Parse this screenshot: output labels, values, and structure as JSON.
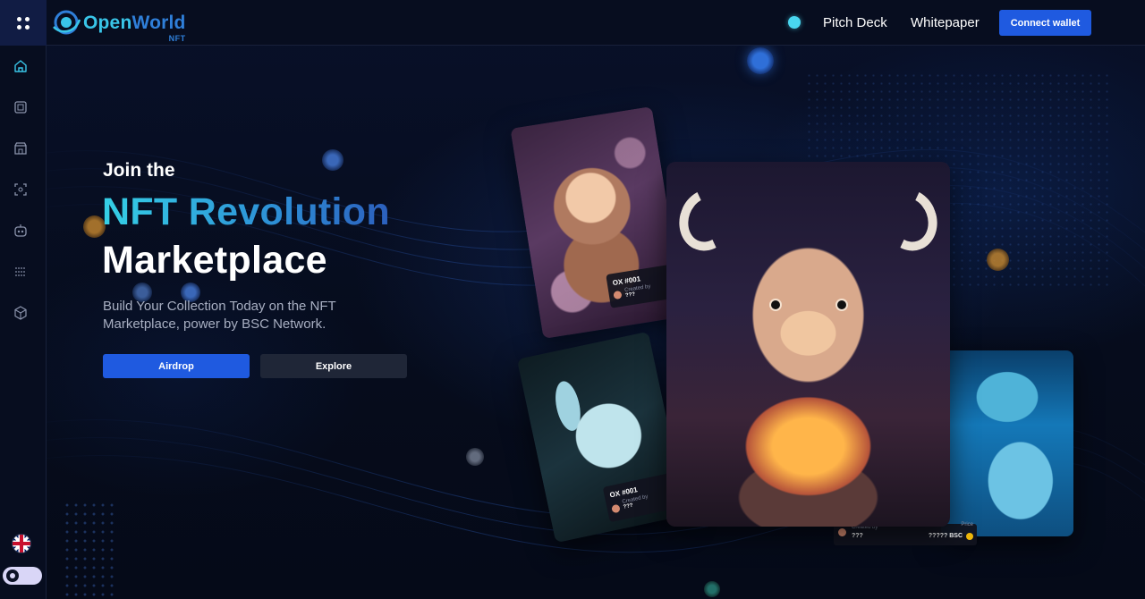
{
  "brand": {
    "name_part1": "Open",
    "name_part2": "World",
    "sub": "NFT"
  },
  "header": {
    "nav": [
      {
        "label": "Pitch Deck"
      },
      {
        "label": "Whitepaper"
      }
    ],
    "connect_label": "Connect wallet"
  },
  "sidebar": {
    "items": [
      {
        "icon": "home-icon"
      },
      {
        "icon": "frame-icon"
      },
      {
        "icon": "store-icon"
      },
      {
        "icon": "focus-icon"
      },
      {
        "icon": "bot-icon"
      },
      {
        "icon": "grid-dots-icon"
      },
      {
        "icon": "cube-icon"
      }
    ],
    "language_icon": "uk-flag-icon",
    "theme_toggle": "dark-mode"
  },
  "hero": {
    "line1": "Join the",
    "line2": "NFT Revolution",
    "line3": "Marketplace",
    "subtitle": "Build Your Collection Today on the NFT Marketplace, power by BSC Network.",
    "primary_button": "Airdrop",
    "secondary_button": "Explore"
  },
  "cards": {
    "monkey": {
      "title": "OX #001",
      "created_by_label": "Created by",
      "creator": "???"
    },
    "horse": {
      "title": "OX #001",
      "created_by_label": "Created by",
      "creator": "???"
    },
    "ox": {
      "created_by_label": "Created by",
      "creator": "???",
      "price_label": "Price",
      "price": "????? BSC"
    }
  },
  "colors": {
    "background": "#070d1f",
    "accent": "#1f5ae0",
    "gradient_start": "#35d0e6",
    "gradient_end": "#2c5fbd"
  }
}
